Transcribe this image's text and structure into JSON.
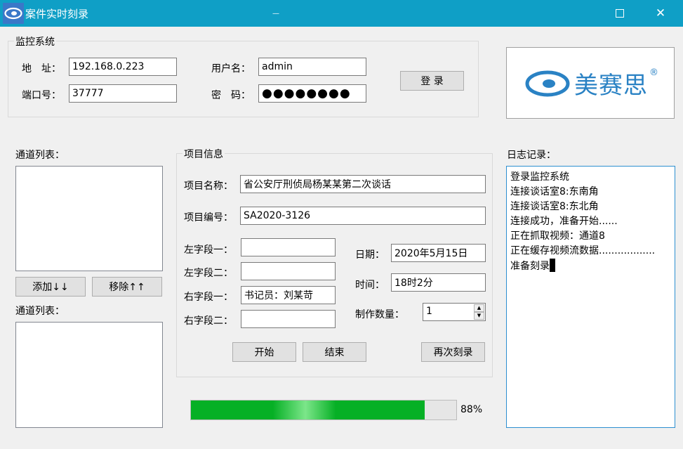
{
  "window": {
    "title": "案件实时刻录",
    "minimize_glyph": "—",
    "maximize_glyph": "☐",
    "close_glyph": "✕"
  },
  "monitor": {
    "group_title": "监控系统",
    "address_label": "地　址：",
    "address_value": "192.168.0.223",
    "port_label": "端口号：",
    "port_value": "37777",
    "username_label": "用户名：",
    "username_value": "admin",
    "password_label": "密　码：",
    "password_value": "●●●●●●●●",
    "login_button": "登 录"
  },
  "logo": {
    "brand_text": "美赛思",
    "registered_mark": "®",
    "brand_color": "#2a82c4"
  },
  "channels": {
    "list1_label": "通道列表：",
    "list2_label": "通道列表：",
    "add_button": "添加↓↓",
    "remove_button": "移除↑↑"
  },
  "project": {
    "group_title": "项目信息",
    "name_label": "项目名称：",
    "name_value": "省公安厅刑侦局杨某某第二次谈话",
    "code_label": "项目编号：",
    "code_value": "SA2020-3126",
    "left1_label": "左字段一：",
    "left1_value": "",
    "left2_label": "左字段二：",
    "left2_value": "",
    "right1_label": "右字段一：",
    "right1_value": "书记员：刘某苛",
    "right2_label": "右字段二：",
    "right2_value": "",
    "date_label": "日期：",
    "date_value": "2020年5月15日",
    "time_label": "时间：",
    "time_value": "18时2分",
    "count_label": "制作数量：",
    "count_value": "1",
    "start_button": "开始",
    "end_button": "结束",
    "reburn_button": "再次刻录"
  },
  "progress": {
    "percent": 88,
    "label": "88%",
    "fill_color": "#06b025"
  },
  "log": {
    "label": "日志记录：",
    "lines": [
      "登录监控系统",
      "连接谈话室8:东南角",
      "连接谈话室8:东北角",
      "连接成功，准备开始......",
      "正在抓取视频：通道8",
      "正在缓存视频流数据..................",
      "准备刻录"
    ]
  }
}
